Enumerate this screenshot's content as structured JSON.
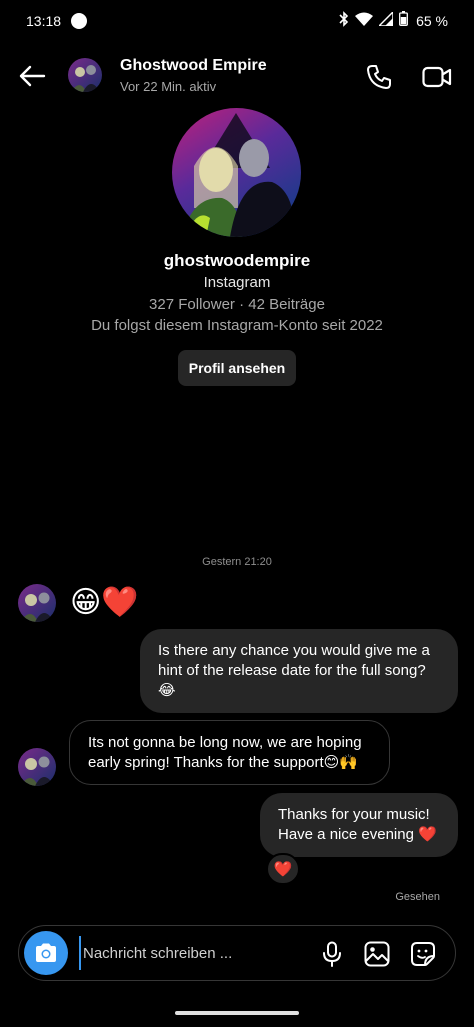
{
  "status_bar": {
    "time": "13:18",
    "battery": "65 %",
    "icons": [
      "bluetooth-icon",
      "wifi-icon",
      "signal-icon",
      "battery-icon"
    ]
  },
  "header": {
    "name": "Ghostwood Empire",
    "status": "Vor 22 Min. aktiv",
    "icons": [
      "back-arrow-icon",
      "phone-icon",
      "video-camera-icon"
    ]
  },
  "profile": {
    "username": "ghostwoodempire",
    "source": "Instagram",
    "stats": "327 Follower · 42 Beiträge",
    "follow_info": "Du folgst diesem Instagram-Konto seit 2022",
    "view_profile_label": "Profil ansehen"
  },
  "conversation": {
    "timestamp": "Gestern 21:20",
    "messages": [
      {
        "direction": "incoming",
        "text": "😁❤️"
      },
      {
        "direction": "outgoing",
        "lines": [
          "Is there any chance you would give me a",
          "hint of the release date for the full song?",
          "😂"
        ]
      },
      {
        "direction": "incoming",
        "lines": [
          "Its not gonna be long now, we are hoping",
          "early spring! Thanks for the support😊🙌"
        ]
      },
      {
        "direction": "outgoing",
        "lines": [
          "Thanks for your music!",
          "Have a nice evening ❤️"
        ]
      }
    ],
    "reaction": "❤️",
    "seen_label": "Gesehen"
  },
  "composer": {
    "placeholder": "Nachricht schreiben ...",
    "value": "",
    "icons": [
      "camera-icon",
      "microphone-icon",
      "gallery-icon",
      "sticker-icon"
    ]
  },
  "colors": {
    "background": "#000000",
    "outgoing_bubble": "#262626",
    "incoming_border": "#363636",
    "accent_blue": "#3797f0",
    "heart_red": "#e8324a"
  }
}
